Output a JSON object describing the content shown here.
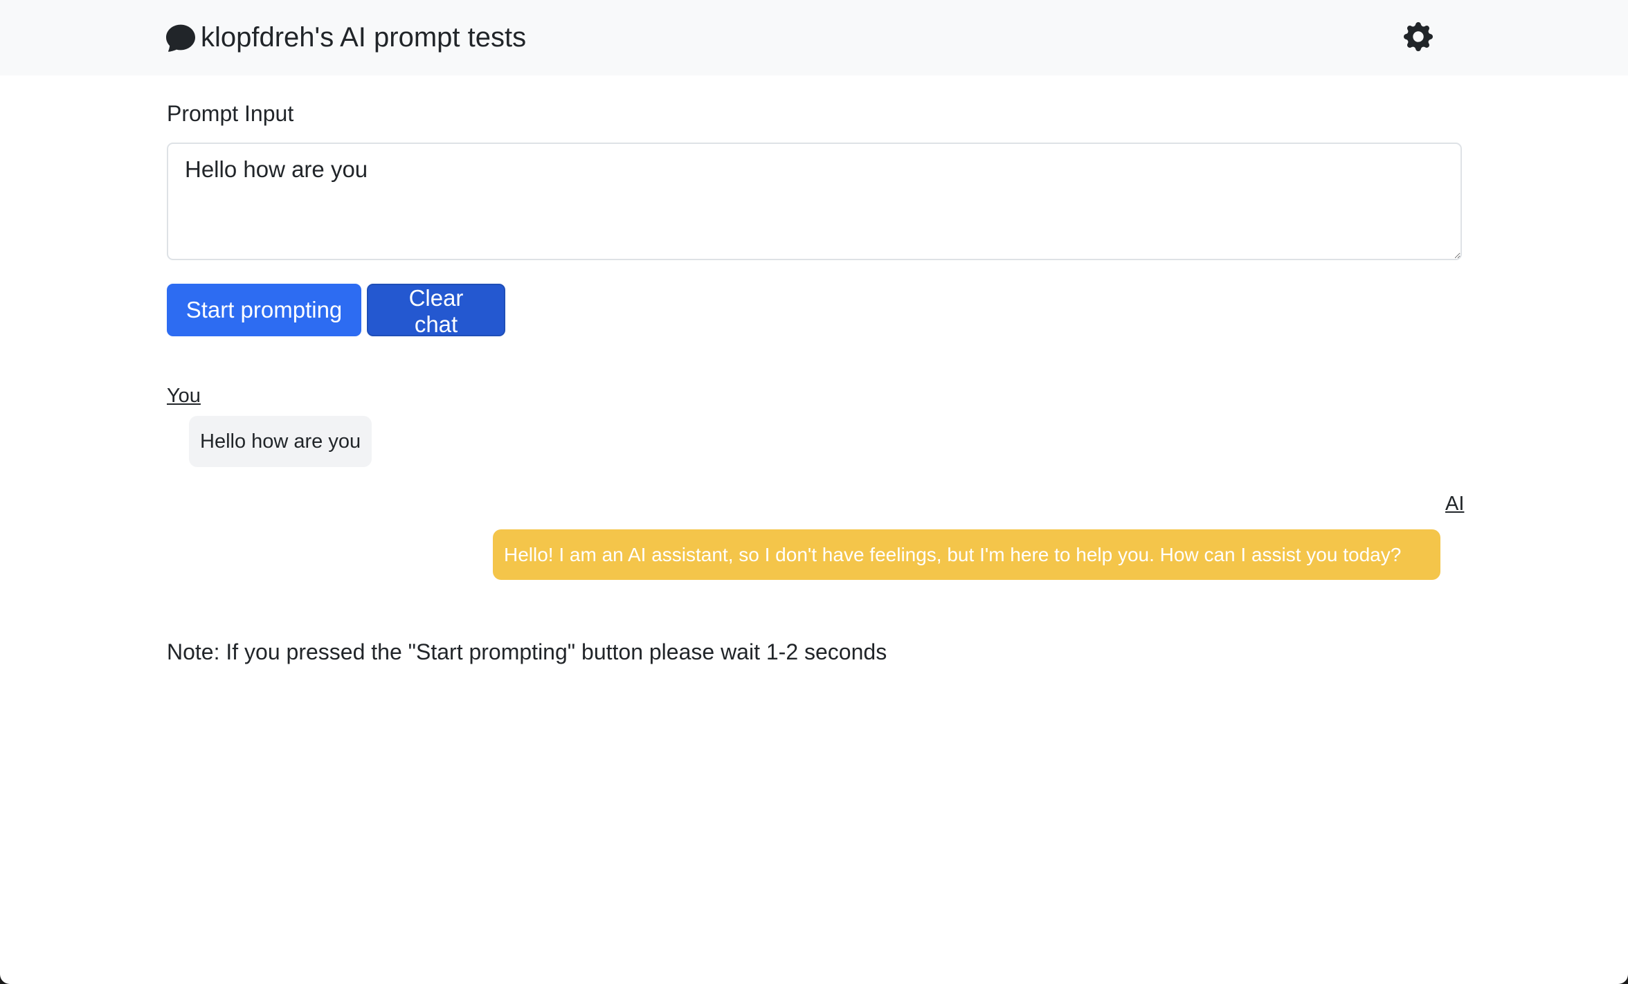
{
  "navbar": {
    "brand_text": "klopfdreh's AI prompt tests",
    "brand_icon": "chat-bubble-icon",
    "settings_icon": "gear-icon"
  },
  "prompt": {
    "label": "Prompt Input",
    "value": "Hello how are you"
  },
  "actions": {
    "start_label": "Start prompting",
    "clear_label": "Clear chat"
  },
  "chat": {
    "messages": [
      {
        "sender": "You",
        "text": "Hello how are you"
      },
      {
        "sender": "AI",
        "text": "Hello! I am an AI assistant, so I don't have feelings, but I'm here to help you. How can I assist you today?"
      }
    ]
  },
  "note": "Note: If you pressed the \"Start prompting\" button please wait 1-2 seconds",
  "colors": {
    "navbar_bg": "#f8f9fa",
    "primary": "#2d6cf2",
    "ai_bubble": "#f4c54a",
    "user_bubble": "#f2f3f5"
  }
}
